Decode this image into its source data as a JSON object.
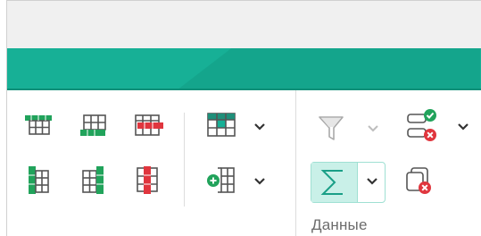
{
  "ribbon": {
    "group_label": "Данные"
  },
  "icons": {
    "insert_row_above": "insert-row-above-icon",
    "insert_row_below": "insert-row-below-icon",
    "delete_row": "delete-row-icon",
    "insert_column_left": "insert-column-left-icon",
    "insert_column_right": "insert-column-right-icon",
    "delete_column": "delete-column-icon",
    "table_style": "table-style-icon",
    "insert_cells": "insert-cells-icon",
    "filter": "filter-icon",
    "data_validation": "data-validation-icon",
    "autosum": "sigma-icon",
    "remove_duplicates": "remove-icon"
  },
  "colors": {
    "accent": "#17b096",
    "green": "#21a35b",
    "red": "#e0363e",
    "gray_icon": "#555555"
  }
}
